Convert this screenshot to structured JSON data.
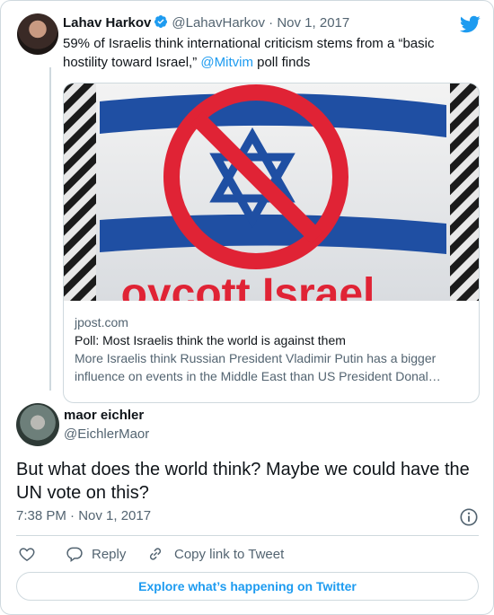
{
  "parent_tweet": {
    "author_name": "Lahav Harkov",
    "author_handle": "@LahavHarkov",
    "separator": "·",
    "date": "Nov 1, 2017",
    "text_before_mention": "59% of Israelis think international criticism stems from a “basic hostility toward Israel,” ",
    "mention": "@Mitvim",
    "text_after_mention": " poll finds",
    "link_card": {
      "image_alt": "Shirt with crossed-out Israeli flag and 'Boycott Israel' text",
      "image_text": "oycott Israel",
      "domain": "jpost.com",
      "title": "Poll: Most Israelis think the world is against them",
      "description": "More Israelis think Russian President Vladimir Putin has a bigger influence on events in the Middle East than US President Donal…"
    }
  },
  "main_tweet": {
    "author_name": "maor eichler",
    "author_handle": "@EichlerMaor",
    "text": "But what does the world think? Maybe we could have the UN vote on this?",
    "timestamp": "7:38 PM · Nov 1, 2017"
  },
  "actions": {
    "reply_label": "Reply",
    "copy_link_label": "Copy link to Tweet"
  },
  "explore_label": "Explore what’s happening on Twitter",
  "icons": {
    "verified": "verified-badge-icon",
    "twitter": "twitter-bird-icon",
    "info": "info-icon",
    "like": "heart-icon",
    "reply": "reply-bubble-icon",
    "copy": "link-icon"
  },
  "colors": {
    "accent": "#1d9bf0",
    "text": "#0f1419",
    "muted": "#536471",
    "border": "#cfd9de"
  }
}
